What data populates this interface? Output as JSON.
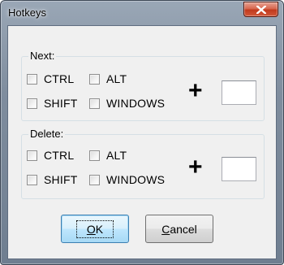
{
  "window": {
    "title": "Hotkeys"
  },
  "titlebar": {
    "close_icon": "close-x-icon"
  },
  "groups": [
    {
      "label": "Next:",
      "checkboxes": [
        {
          "label": "CTRL",
          "checked": false
        },
        {
          "label": "ALT",
          "checked": false
        },
        {
          "label": "SHIFT",
          "checked": false
        },
        {
          "label": "WINDOWS",
          "checked": false
        }
      ],
      "plus": "+",
      "key_value": ""
    },
    {
      "label": "Delete:",
      "checkboxes": [
        {
          "label": "CTRL",
          "checked": false
        },
        {
          "label": "ALT",
          "checked": false
        },
        {
          "label": "SHIFT",
          "checked": false
        },
        {
          "label": "WINDOWS",
          "checked": false
        }
      ],
      "plus": "+",
      "key_value": ""
    }
  ],
  "buttons": {
    "ok": {
      "mnemonic": "O",
      "rest": "K"
    },
    "cancel": {
      "mnemonic": "C",
      "rest": "ancel"
    }
  },
  "colors": {
    "title_bar": "#8f9caf",
    "close_button": "#c7432a",
    "dialog_face": "#f0f0f0",
    "default_button": "#bee6fd"
  }
}
